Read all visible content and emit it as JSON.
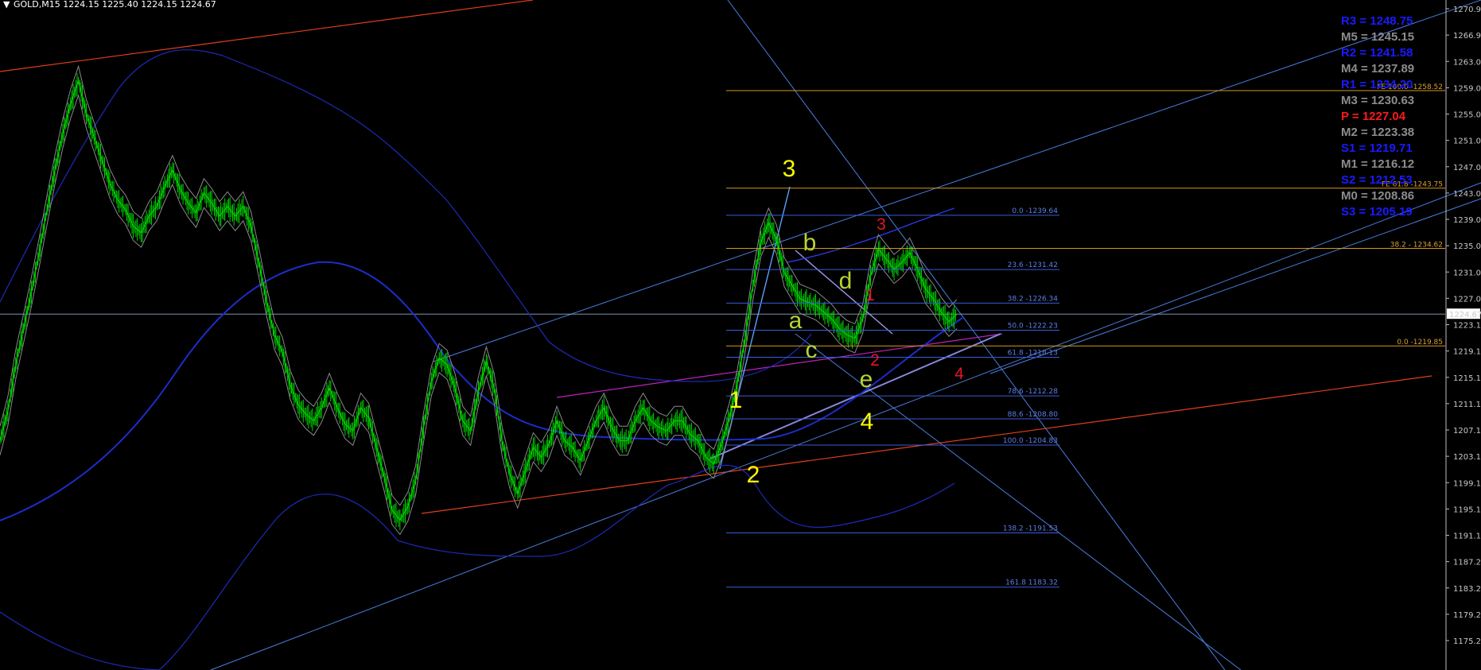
{
  "header": {
    "symbol_label": "GOLD,M15  1224.15 1225.40 1224.15 1224.67",
    "menu_glyph": "▼"
  },
  "chart_data": {
    "type": "line",
    "symbol": "GOLD",
    "timeframe": "M15",
    "ohlc": {
      "open": 1224.15,
      "high": 1225.4,
      "low": 1224.15,
      "close": 1224.67
    },
    "ylim": [
      1171.12,
      1272.0
    ],
    "y_ticks": [
      "1270.92",
      "1266.92",
      "1263.02",
      "1259.02",
      "1255.02",
      "1251.02",
      "1247.02",
      "1243.02",
      "1239.02",
      "1235.02",
      "1231.02",
      "1227.02",
      "1223.12",
      "1219.12",
      "1215.12",
      "1211.12",
      "1207.12",
      "1203.12",
      "1199.12",
      "1195.12",
      "1191.12",
      "1187.22",
      "1183.22",
      "1179.22",
      "1175.22"
    ],
    "current_price_label": "1224.67",
    "current_price": 1224.67,
    "grid": false,
    "series": [
      {
        "color": "#00d000",
        "values": [
          1205.5,
          1210.0,
          1217.0,
          1222.5,
          1228.0,
          1234.0,
          1240.5,
          1246.5,
          1252.0,
          1256.5,
          1260.0,
          1255.0,
          1251.5,
          1248.0,
          1244.5,
          1242.0,
          1240.5,
          1238.0,
          1237.0,
          1239.5,
          1241.0,
          1244.0,
          1246.5,
          1243.5,
          1241.5,
          1240.0,
          1243.0,
          1241.5,
          1239.5,
          1241.0,
          1239.5,
          1241.0,
          1238.0,
          1232.5,
          1226.5,
          1221.5,
          1219.0,
          1214.0,
          1211.0,
          1209.5,
          1208.5,
          1210.5,
          1213.5,
          1210.5,
          1208.0,
          1207.0,
          1210.5,
          1209.0,
          1204.5,
          1200.0,
          1195.0,
          1193.5,
          1195.5,
          1199.5,
          1207.5,
          1214.5,
          1218.0,
          1217.0,
          1213.5,
          1208.5,
          1207.0,
          1213.0,
          1217.5,
          1213.5,
          1205.5,
          1200.5,
          1197.5,
          1201.0,
          1204.5,
          1203.0,
          1205.0,
          1208.5,
          1205.5,
          1204.5,
          1202.5,
          1205.5,
          1208.5,
          1210.5,
          1207.5,
          1205.5,
          1205.5,
          1208.5,
          1210.5,
          1208.5,
          1207.5,
          1207.0,
          1208.5,
          1208.5,
          1206.5,
          1205.5,
          1203.0,
          1202.0,
          1205.0,
          1209.0,
          1214.0,
          1221.0,
          1229.0,
          1235.5,
          1238.5,
          1236.0,
          1231.0,
          1229.0,
          1227.0,
          1226.5,
          1226.0,
          1225.0,
          1224.0,
          1222.5,
          1221.5,
          1221.0,
          1224.0,
          1230.5,
          1234.5,
          1233.0,
          1231.5,
          1232.5,
          1234.0,
          1231.5,
          1228.5,
          1227.0,
          1225.0,
          1223.5,
          1224.67
        ]
      }
    ],
    "indicators": {
      "moving_averages": [
        "blue",
        "grey"
      ],
      "bands": [
        "upper",
        "lower"
      ]
    },
    "fibonacci_retracement": [
      {
        "label": "0.0 -1239.64",
        "value": 1239.64
      },
      {
        "label": "23.6 -1231.42",
        "value": 1231.42
      },
      {
        "label": "38.2 -1226.34",
        "value": 1226.34
      },
      {
        "label": "50.0 -1222.23",
        "value": 1222.23
      },
      {
        "label": "61.8 -1218.13",
        "value": 1218.13
      },
      {
        "label": "78.6 -1212.28",
        "value": 1212.28
      },
      {
        "label": "88.6 -1208.80",
        "value": 1208.8
      },
      {
        "label": "100.0 -1204.83",
        "value": 1204.83
      },
      {
        "label": "138.2 -1191.53",
        "value": 1191.53
      },
      {
        "label": "161.8 1183.32",
        "value": 1183.32
      }
    ],
    "fibonacci_extension": [
      {
        "label": "FE 100.0 -1258.52",
        "value": 1258.52
      },
      {
        "label": "FE 61.8 -1243.75",
        "value": 1243.75
      },
      {
        "label": "38.2 - 1234.62",
        "value": 1234.62
      },
      {
        "label": "0.0 -1219.85",
        "value": 1219.85
      }
    ],
    "pivot_levels": [
      {
        "label": "R3 = 1248.75",
        "color": "#1a1aff"
      },
      {
        "label": "M5 = 1245.15",
        "color": "#8c8c8c"
      },
      {
        "label": "R2 = 1241.58",
        "color": "#1a1aff"
      },
      {
        "label": "M4 = 1237.89",
        "color": "#8c8c8c"
      },
      {
        "label": "R1 = 1234.20",
        "color": "#1a1aff"
      },
      {
        "label": "M3 = 1230.63",
        "color": "#8c8c8c"
      },
      {
        "label": "P   = 1227.04",
        "color": "#ff1a1a"
      },
      {
        "label": "M2 = 1223.38",
        "color": "#8c8c8c"
      },
      {
        "label": "S1 = 1219.71",
        "color": "#1a1aff"
      },
      {
        "label": "M1 = 1216.12",
        "color": "#8c8c8c"
      },
      {
        "label": "S2 = 1212.53",
        "color": "#1a1aff"
      },
      {
        "label": "M0 = 1208.86",
        "color": "#8c8c8c"
      },
      {
        "label": "S3 = 1205.19",
        "color": "#1a1aff"
      }
    ],
    "wave_labels": [
      {
        "text": "3",
        "color": "#ffff00"
      },
      {
        "text": "1",
        "color": "#ffff00"
      },
      {
        "text": "2",
        "color": "#ffff00"
      },
      {
        "text": "4",
        "color": "#ffff00"
      },
      {
        "text": "a",
        "color": "#b5d334"
      },
      {
        "text": "b",
        "color": "#b5d334"
      },
      {
        "text": "c",
        "color": "#b5d334"
      },
      {
        "text": "d",
        "color": "#b5d334"
      },
      {
        "text": "e",
        "color": "#b5d334"
      },
      {
        "text": "3",
        "color": "#e8142a"
      },
      {
        "text": "1",
        "color": "#e8142a"
      },
      {
        "text": "2",
        "color": "#e8142a"
      },
      {
        "text": "4",
        "color": "#e8142a"
      }
    ],
    "colors": {
      "background": "#000000",
      "price": "#00d000",
      "fib_retracement": "#3a5dd8",
      "fib_extension": "#d49a18",
      "trendline_orange": "#e0401a",
      "trendline_magenta": "#c020c0",
      "channel_lines": "#4a7ee0",
      "moving_average": "#1c2dcc"
    }
  }
}
